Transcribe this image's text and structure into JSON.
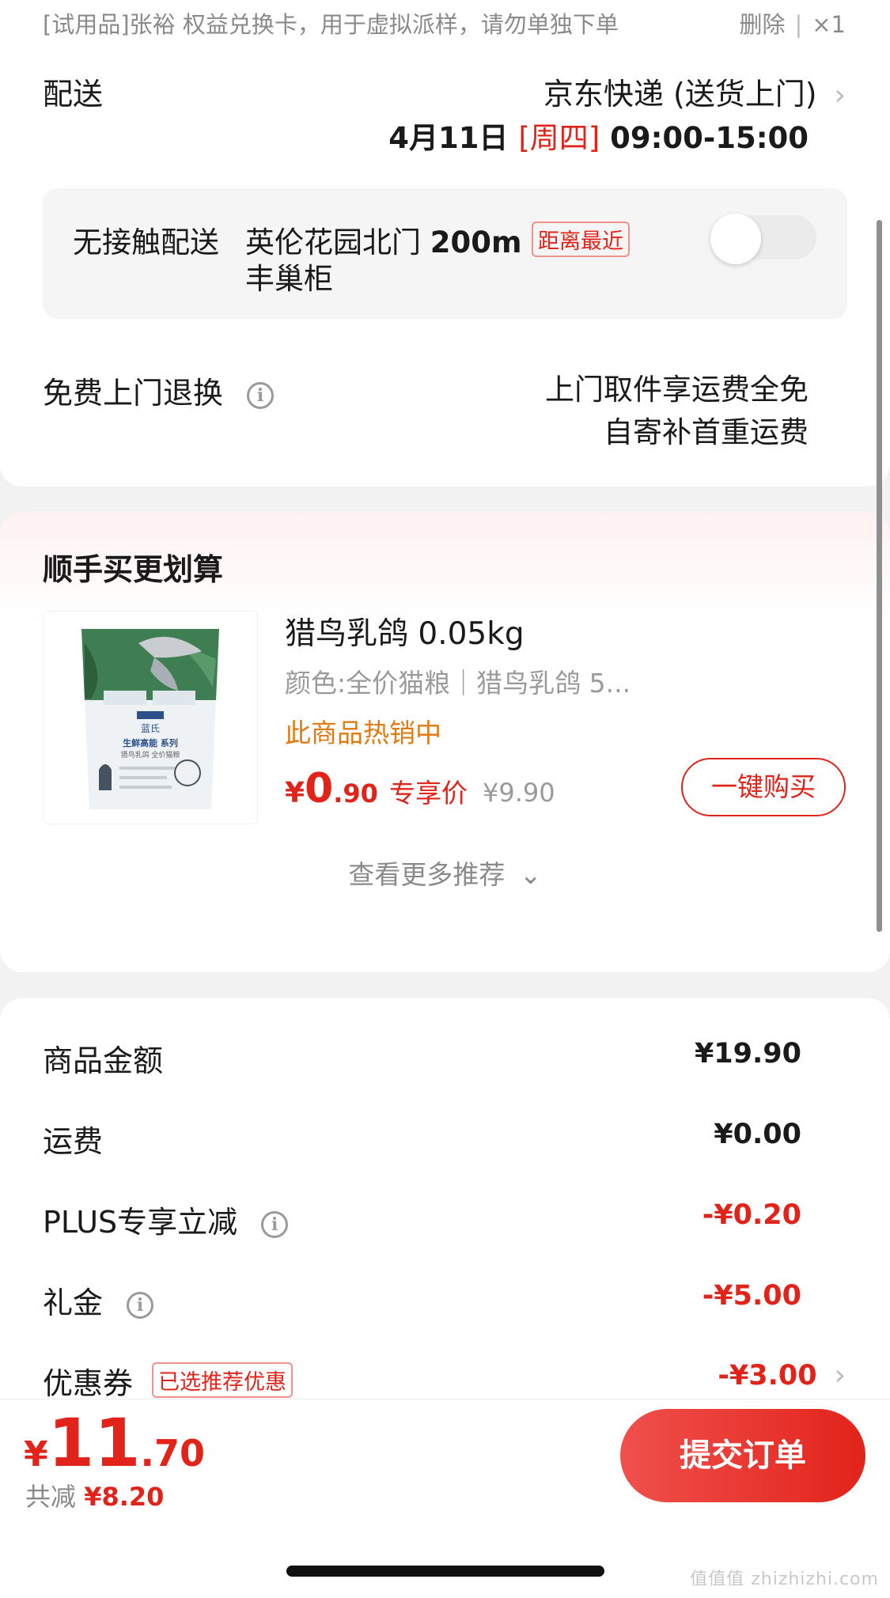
{
  "trial_item": {
    "text": "[试用品]张裕 权益兑换卡，用于虚拟派样，请勿单独下单",
    "delete_label": "删除",
    "quantity": "×1"
  },
  "delivery": {
    "label": "配送",
    "method": "京东快递 (送货上门)",
    "date": "4月11日",
    "weekday": "[周四]",
    "time": "09:00-15:00",
    "contactless": {
      "label": "无接触配送",
      "place": "英伦花园北门",
      "distance": "200m",
      "tag": "距离最近",
      "cabinet": "丰巢柜",
      "enabled": false
    }
  },
  "returns": {
    "label": "免费上门退换",
    "line1": "上门取件享运费全免",
    "line2": "自寄补首重运费"
  },
  "recommend": {
    "title": "顺手买更划算",
    "product": {
      "name": "猎鸟乳鸽 0.05kg",
      "spec": "颜色:全价猫粮｜猎鸟乳鸽 5...",
      "hot": "此商品热销中",
      "price_currency": "¥",
      "price_int": "0",
      "price_dec": ".90",
      "exclusive_label": "专享价",
      "original_price": "¥9.90",
      "buy_label": "一键购买",
      "image_brand": "蓝氏",
      "image_series": "生鲜高能 系列",
      "image_sub": "猎鸟乳鸽 全价猫粮"
    },
    "more_label": "查看更多推荐"
  },
  "summary": {
    "goods_label": "商品金额",
    "goods_value": "¥19.90",
    "shipping_label": "运费",
    "shipping_value": "¥0.00",
    "plus_label": "PLUS专享立减",
    "plus_value": "-¥0.20",
    "gift_label": "礼金",
    "gift_value": "-¥5.00",
    "coupon_label": "优惠券",
    "coupon_tag": "已选推荐优惠",
    "coupon_value": "-¥3.00"
  },
  "footer": {
    "total_currency": "¥",
    "total_int": "11",
    "total_dec": ".70",
    "saved_label": "共减",
    "saved_value": "¥8.20",
    "submit_label": "提交订单"
  },
  "watermark": "值值值 zhizhizhi.com",
  "colors": {
    "accent_red": "#e2231a",
    "hot_orange": "#e27a13",
    "muted_gray": "#9a9a9a",
    "page_bg": "#f2f2f2"
  }
}
